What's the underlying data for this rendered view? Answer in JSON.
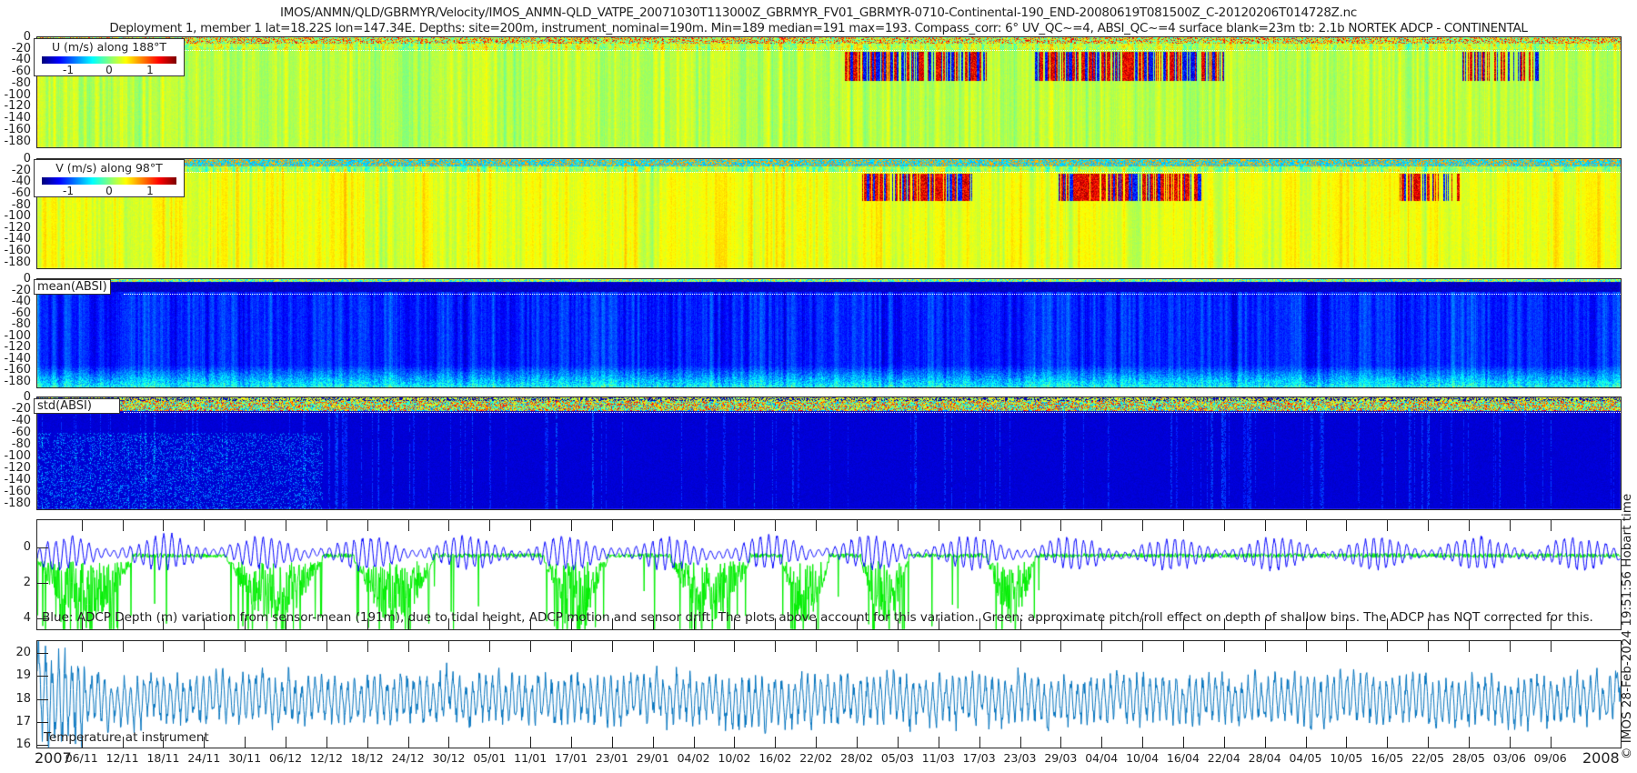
{
  "title": {
    "line1": "IMOS/ANMN/QLD/GBRMYR/Velocity/IMOS_ANMN-QLD_VATPE_20071030T113000Z_GBRMYR_FV01_GBRMYR-0710-Continental-190_END-20080619T081500Z_C-20120206T014728Z.nc",
    "line2": "Deployment 1, member 1 lat=18.22S lon=147.34E. Depths: site=200m, instrument_nominal=190m. Min=189 median=191 max=193. Compass_corr: 6° UV_QC~=4, ABSI_QC~=4 surface blank=23m tb: 2.1b NORTEK ADCP - CONTINENTAL"
  },
  "depth_yticks": [
    "0",
    "-20",
    "-40",
    "-60",
    "-80",
    "-100",
    "-120",
    "-140",
    "-160",
    "-180"
  ],
  "panels": {
    "u": {
      "label": "U (m/s) along 188°T",
      "cb_ticks": [
        "-1",
        "0",
        "1"
      ]
    },
    "v": {
      "label": "V (m/s) along 98°T",
      "cb_ticks": [
        "-1",
        "0",
        "1"
      ]
    },
    "mean": {
      "label": "mean(ABSI)"
    },
    "std": {
      "label": "std(ABSI)"
    },
    "depth": {
      "yticks": [
        "0",
        "2",
        "4"
      ],
      "annotation": "Blue: ADCP Depth (m) variation from sensor-mean (191m), due to tidal height, ADCP motion and sensor drift. The plots above account for this variation. Green: approximate pitch/roll effect on depth of shallow bins. The ADCP has NOT corrected for this."
    },
    "temp": {
      "yticks": [
        "16",
        "17",
        "18",
        "19",
        "20"
      ],
      "annotation": "Temperature at instrument"
    }
  },
  "xticks": [
    "06/11",
    "12/11",
    "18/11",
    "24/11",
    "30/11",
    "06/12",
    "12/12",
    "18/12",
    "24/12",
    "30/12",
    "05/01",
    "11/01",
    "17/01",
    "23/01",
    "29/01",
    "04/02",
    "10/02",
    "16/02",
    "22/02",
    "28/02",
    "05/03",
    "11/03",
    "17/03",
    "23/03",
    "29/03",
    "04/04",
    "10/04",
    "16/04",
    "22/04",
    "28/04",
    "04/05",
    "10/05",
    "16/05",
    "22/05",
    "28/05",
    "03/06",
    "09/06"
  ],
  "years": {
    "start": "2007",
    "end": "2008"
  },
  "copyright": "© IMOS 28-Feb-2024 19:51:56 Hobart time",
  "chart_data": [
    {
      "type": "heatmap",
      "name": "U (m/s) along 188°T",
      "colormap": "jet",
      "clim": [
        -1.6,
        1.6
      ],
      "ylim": [
        -190,
        0
      ],
      "xlim": [
        "2007-10-30T11:30",
        "2008-06-19T08:15"
      ],
      "surface_blank_m": 23
    },
    {
      "type": "heatmap",
      "name": "V (m/s) along 98°T",
      "colormap": "jet",
      "clim": [
        -1.6,
        1.6
      ],
      "ylim": [
        -190,
        0
      ],
      "xlim": [
        "2007-10-30T11:30",
        "2008-06-19T08:15"
      ],
      "surface_blank_m": 23
    },
    {
      "type": "heatmap",
      "name": "mean(ABSI)",
      "colormap": "jet",
      "ylim": [
        -190,
        0
      ]
    },
    {
      "type": "heatmap",
      "name": "std(ABSI)",
      "colormap": "jet",
      "ylim": [
        -190,
        0
      ]
    },
    {
      "type": "line",
      "ylim": [
        4.6,
        -1.5
      ],
      "yreversed": true,
      "series_colors": {
        "adcp_depth": "#0000ff",
        "pitch_roll": "#00ee00"
      }
    },
    {
      "type": "line",
      "ylim": [
        15.9,
        20.5
      ],
      "series_colors": {
        "temperature": "#0072bd"
      }
    }
  ],
  "colors": {
    "frame": "#222222",
    "dotted_line": "#ffffff"
  }
}
